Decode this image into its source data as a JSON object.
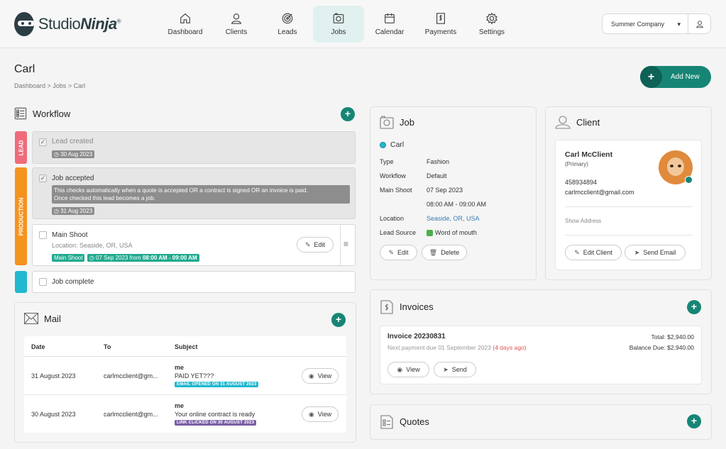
{
  "app": {
    "brand_main": "Studio",
    "brand_accent": "Ninja",
    "brand_mark": "®"
  },
  "nav": [
    {
      "label": "Dashboard",
      "icon": "home-icon",
      "active": false
    },
    {
      "label": "Clients",
      "icon": "user-icon",
      "active": false
    },
    {
      "label": "Leads",
      "icon": "target-icon",
      "active": false
    },
    {
      "label": "Jobs",
      "icon": "camera-icon",
      "active": true
    },
    {
      "label": "Calendar",
      "icon": "calendar-icon",
      "active": false
    },
    {
      "label": "Payments",
      "icon": "dollar-document-icon",
      "active": false
    },
    {
      "label": "Settings",
      "icon": "gear-icon",
      "active": false
    }
  ],
  "company": {
    "selected": "Summer Company"
  },
  "page": {
    "title": "Carl",
    "breadcrumbs": [
      "Dashboard",
      "Jobs",
      "Carl"
    ],
    "add_new": "Add New"
  },
  "workflow": {
    "title": "Workflow",
    "stages": {
      "lead": "LEAD",
      "production": "PRODUCTION"
    },
    "tasks": {
      "lead_created": {
        "label": "Lead created",
        "date": "30 Aug 2023"
      },
      "job_accepted": {
        "label": "Job accepted",
        "note_line1": "This checks automatically when a quote is accepted OR a contract is signed OR an invoice is paid.",
        "note_line2": "Once checked this lead becomes a job.",
        "date": "31 Aug 2023"
      },
      "main_shoot": {
        "label": "Main Shoot",
        "location": "Location: Seaside, OR, USA",
        "tag": "Main Shoot",
        "when": "07 Sep 2023 from ",
        "time": "08:00 AM - 09:00 AM",
        "edit": "Edit"
      },
      "job_complete": {
        "label": "Job complete"
      }
    }
  },
  "mail": {
    "title": "Mail",
    "headers": {
      "date": "Date",
      "to": "To",
      "subject": "Subject"
    },
    "rows": [
      {
        "date": "31 August 2023",
        "to": "carlmcclient@gm...",
        "from": "me",
        "subject": "PAID YET???",
        "badge": "EMAIL OPENED ON 31 AUGUST 2023",
        "action": "View"
      },
      {
        "date": "30 August 2023",
        "to": "carlmcclient@gm...",
        "from": "me",
        "subject": "Your online contract is ready",
        "badge": "LINK CLICKED ON 30 AUGUST 2023",
        "action": "View"
      }
    ]
  },
  "job": {
    "title": "Job",
    "name": "Carl",
    "labels": {
      "type": "Type",
      "workflow": "Workflow",
      "main_shoot": "Main Shoot",
      "location": "Location",
      "lead_source": "Lead Source"
    },
    "values": {
      "type": "Fashion",
      "workflow": "Default",
      "main_shoot_date": "07 Sep 2023",
      "main_shoot_time": "08:00 AM - 09:00 AM",
      "location": "Seaside, OR, USA",
      "lead_source": "Word of mouth"
    },
    "edit": "Edit",
    "delete": "Delete"
  },
  "client": {
    "title": "Client",
    "name": "Carl McClient",
    "role": "(Primary)",
    "phone": "458934894",
    "email": "carlmcclient@gmail.com",
    "show_address": "Show Address",
    "edit": "Edit Client",
    "send": "Send Email"
  },
  "invoices": {
    "title": "Invoices",
    "invoice_name": "Invoice 20230831",
    "next_due": "Next payment due 01 September 2023 ",
    "due_note": "(4 days ago)",
    "total": "Total: $2,940.00",
    "balance": "Balance Due: $2,940.00",
    "view": "View",
    "send": "Send"
  },
  "quotes": {
    "title": "Quotes"
  },
  "colors": {
    "primary": "#178575",
    "lead": "#ef6b7a",
    "production": "#f5931f",
    "complete": "#21b8cf",
    "job_dot": "#21b8cf",
    "lead_source": "#4cae4c",
    "badge_opened": "#21b8cf",
    "badge_clicked": "#7b5ea7"
  }
}
